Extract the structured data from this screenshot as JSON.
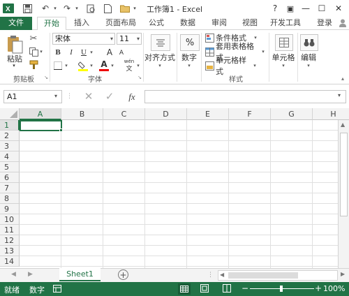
{
  "titlebar": {
    "title": "工作簿1 - Excel",
    "help": "?",
    "ribbon_display": "▣",
    "minimize": "—",
    "maximize": "☐",
    "close": "✕"
  },
  "tabs": [
    {
      "label": "文件"
    },
    {
      "label": "开始"
    },
    {
      "label": "插入"
    },
    {
      "label": "页面布局"
    },
    {
      "label": "公式"
    },
    {
      "label": "数据"
    },
    {
      "label": "审阅"
    },
    {
      "label": "视图"
    },
    {
      "label": "开发工具"
    },
    {
      "label": "登录"
    }
  ],
  "ribbon": {
    "clipboard": {
      "paste": "粘贴",
      "group": "剪贴板"
    },
    "font": {
      "name": "宋体",
      "size": "11",
      "bold": "B",
      "italic": "I",
      "underline": "U",
      "grow": "A",
      "shrink": "A",
      "font_color": "A",
      "phonetic": "wén",
      "phonetic_char": "文",
      "group": "字体"
    },
    "alignment": {
      "label": "对齐方式"
    },
    "number": {
      "label": "数字",
      "symbol": "%"
    },
    "styles": {
      "conditional": "条件格式",
      "table": "套用表格格式",
      "cell_styles": "单元格样式",
      "group": "样式"
    },
    "cells": {
      "label": "单元格"
    },
    "editing": {
      "label": "编辑"
    }
  },
  "formula_bar": {
    "name_box": "A1",
    "fx": "fx",
    "cancel": "✕",
    "enter": "✓",
    "value": ""
  },
  "grid": {
    "columns": [
      "A",
      "B",
      "C",
      "D",
      "E",
      "F",
      "G",
      "H"
    ],
    "rows": [
      "1",
      "2",
      "3",
      "4",
      "5",
      "6",
      "7",
      "8",
      "9",
      "10",
      "11",
      "12",
      "13",
      "14"
    ]
  },
  "sheets": {
    "tabs": [
      {
        "label": "Sheet1"
      }
    ],
    "add": "+"
  },
  "status": {
    "ready": "就绪",
    "numlock": "数字",
    "zoom": "100%",
    "zoom_minus": "−",
    "zoom_plus": "+"
  },
  "colors": {
    "brand": "#217346",
    "selection": "#217346"
  }
}
